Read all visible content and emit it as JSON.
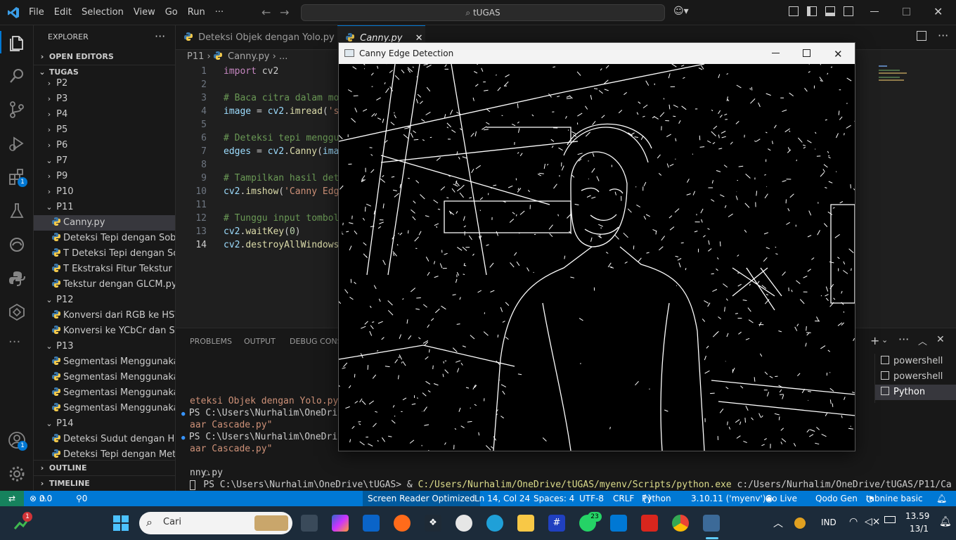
{
  "titlebar": {
    "menu": [
      "File",
      "Edit",
      "Selection",
      "View",
      "Go",
      "Run",
      "···"
    ],
    "search": "tUGAS"
  },
  "activity": {
    "extensions_badge": "1",
    "accounts_badge": "1"
  },
  "sidebar": {
    "title": "EXPLORER",
    "open_editors": "OPEN EDITORS",
    "root": "TUGAS",
    "items": [
      {
        "label": "P2",
        "type": "folder"
      },
      {
        "label": "P3",
        "type": "folder"
      },
      {
        "label": "P4",
        "type": "folder"
      },
      {
        "label": "P5",
        "type": "folder"
      },
      {
        "label": "P6",
        "type": "folder"
      },
      {
        "label": "P7",
        "type": "folder-open"
      },
      {
        "label": "P9",
        "type": "folder"
      },
      {
        "label": "P10",
        "type": "folder"
      },
      {
        "label": "P11",
        "type": "folder-open"
      },
      {
        "label": "Canny.py",
        "type": "file",
        "selected": true
      },
      {
        "label": "Deteksi Tepi dengan Sobe...",
        "type": "file"
      },
      {
        "label": "T Deteksi Tepi dengan So...",
        "type": "file"
      },
      {
        "label": "T Ekstraksi Fitur Tekstur M...",
        "type": "file"
      },
      {
        "label": "Tekstur dengan GLCM.py",
        "type": "file"
      },
      {
        "label": "P12",
        "type": "folder-open"
      },
      {
        "label": "Konversi dari RGB ke HSV....",
        "type": "file"
      },
      {
        "label": "Konversi ke YCbCr dan Se...",
        "type": "file"
      },
      {
        "label": "P13",
        "type": "folder-open"
      },
      {
        "label": "Segmentasi Menggunaka...",
        "type": "file"
      },
      {
        "label": "Segmentasi Menggunaka...",
        "type": "file"
      },
      {
        "label": "Segmentasi Menggunaka...",
        "type": "file"
      },
      {
        "label": "Segmentasi Menggunaka...",
        "type": "file"
      },
      {
        "label": "P14",
        "type": "folder-open"
      },
      {
        "label": "Deteksi Sudut dengan Har...",
        "type": "file"
      },
      {
        "label": "Deteksi Tepi dengan Meto...",
        "type": "file"
      }
    ],
    "outline": "OUTLINE",
    "timeline": "TIMELINE"
  },
  "tabs": [
    {
      "label": "Deteksi Objek dengan Yolo.py",
      "active": false
    },
    {
      "label": "Canny.py",
      "active": true
    }
  ],
  "breadcrumb": {
    "folder": "P11",
    "file": "Canny.py",
    "rest": "..."
  },
  "code": [
    {
      "n": "1",
      "parts": [
        [
          "kw",
          "import"
        ],
        [
          "tx",
          " cv2"
        ]
      ]
    },
    {
      "n": "2",
      "parts": []
    },
    {
      "n": "3",
      "parts": [
        [
          "cm",
          "# Baca citra dalam mo"
        ]
      ]
    },
    {
      "n": "4",
      "parts": [
        [
          "var",
          "image"
        ],
        [
          "tx",
          " = "
        ],
        [
          "var",
          "cv2"
        ],
        [
          "tx",
          "."
        ],
        [
          "fn",
          "imread"
        ],
        [
          "tx",
          "("
        ],
        [
          "str",
          "'s"
        ]
      ]
    },
    {
      "n": "5",
      "parts": []
    },
    {
      "n": "6",
      "parts": [
        [
          "cm",
          "# Deteksi tepi menggu"
        ]
      ]
    },
    {
      "n": "7",
      "parts": [
        [
          "var",
          "edges"
        ],
        [
          "tx",
          " = "
        ],
        [
          "var",
          "cv2"
        ],
        [
          "tx",
          "."
        ],
        [
          "fn",
          "Canny"
        ],
        [
          "tx",
          "("
        ],
        [
          "var",
          "ima"
        ]
      ]
    },
    {
      "n": "8",
      "parts": []
    },
    {
      "n": "9",
      "parts": [
        [
          "cm",
          "# Tampilkan hasil det"
        ]
      ]
    },
    {
      "n": "10",
      "parts": [
        [
          "var",
          "cv2"
        ],
        [
          "tx",
          "."
        ],
        [
          "fn",
          "imshow"
        ],
        [
          "tx",
          "("
        ],
        [
          "str",
          "'Canny Edg"
        ]
      ]
    },
    {
      "n": "11",
      "parts": []
    },
    {
      "n": "12",
      "parts": [
        [
          "cm",
          "# Tunggu input tombol"
        ]
      ]
    },
    {
      "n": "13",
      "parts": [
        [
          "var",
          "cv2"
        ],
        [
          "tx",
          "."
        ],
        [
          "fn",
          "waitKey"
        ],
        [
          "tx",
          "("
        ],
        [
          "num",
          "0"
        ],
        [
          "tx",
          ")"
        ]
      ]
    },
    {
      "n": "14",
      "parts": [
        [
          "var",
          "cv2"
        ],
        [
          "tx",
          "."
        ],
        [
          "fn",
          "destroyAllWindows"
        ]
      ]
    }
  ],
  "panel": {
    "tabs": [
      "PROBLEMS",
      "OUTPUT",
      "DEBUG CONS"
    ],
    "terminal_lines": [
      {
        "text": "eteksi Objek dengan Yolo.py\"",
        "cls": "path"
      },
      {
        "text": "PS C:\\Users\\Nurhalim\\OneDrive\\",
        "cls": "ps",
        "dot": "blue"
      },
      {
        "text": "aar Cascade.py\"",
        "cls": "path"
      },
      {
        "text": "PS C:\\Users\\Nurhalim\\OneDrive\\",
        "cls": "ps",
        "dot": "blue"
      },
      {
        "text": "aar Cascade.py\"",
        "cls": "path"
      }
    ],
    "prompt": "PS C:\\Users\\Nurhalim\\OneDrive\\tUGAS> ",
    "cmd_amp": "& ",
    "cmd_exe": "C:/Users/Nurhalim/OneDrive/tUGAS/myenv/Scripts/python.exe",
    "cmd_arg": " c:/Users/Nurhalim/OneDrive/tUGAS/P11/Ca",
    "cmd_wrap": "nny.py",
    "shells": [
      "powershell",
      "powershell",
      "Python"
    ]
  },
  "status": {
    "errors": "0",
    "warnings": "0",
    "ports": "0",
    "reader": "Screen Reader Optimized",
    "position": "Ln 14, Col 24",
    "spaces": "Spaces: 4",
    "encoding": "UTF-8",
    "eol": "CRLF",
    "lang": "Python",
    "interpreter": "3.10.11 ('myenv')",
    "golive": "Go Live",
    "qodo": "Qodo Gen",
    "tabnine": "tabnine basic"
  },
  "taskbar": {
    "search": "Cari",
    "notif_badge": "1",
    "whatsapp_badge": "23",
    "lang": "IND",
    "time": "13.59",
    "date": "13/1"
  },
  "canny_window": {
    "title": "Canny Edge Detection"
  }
}
